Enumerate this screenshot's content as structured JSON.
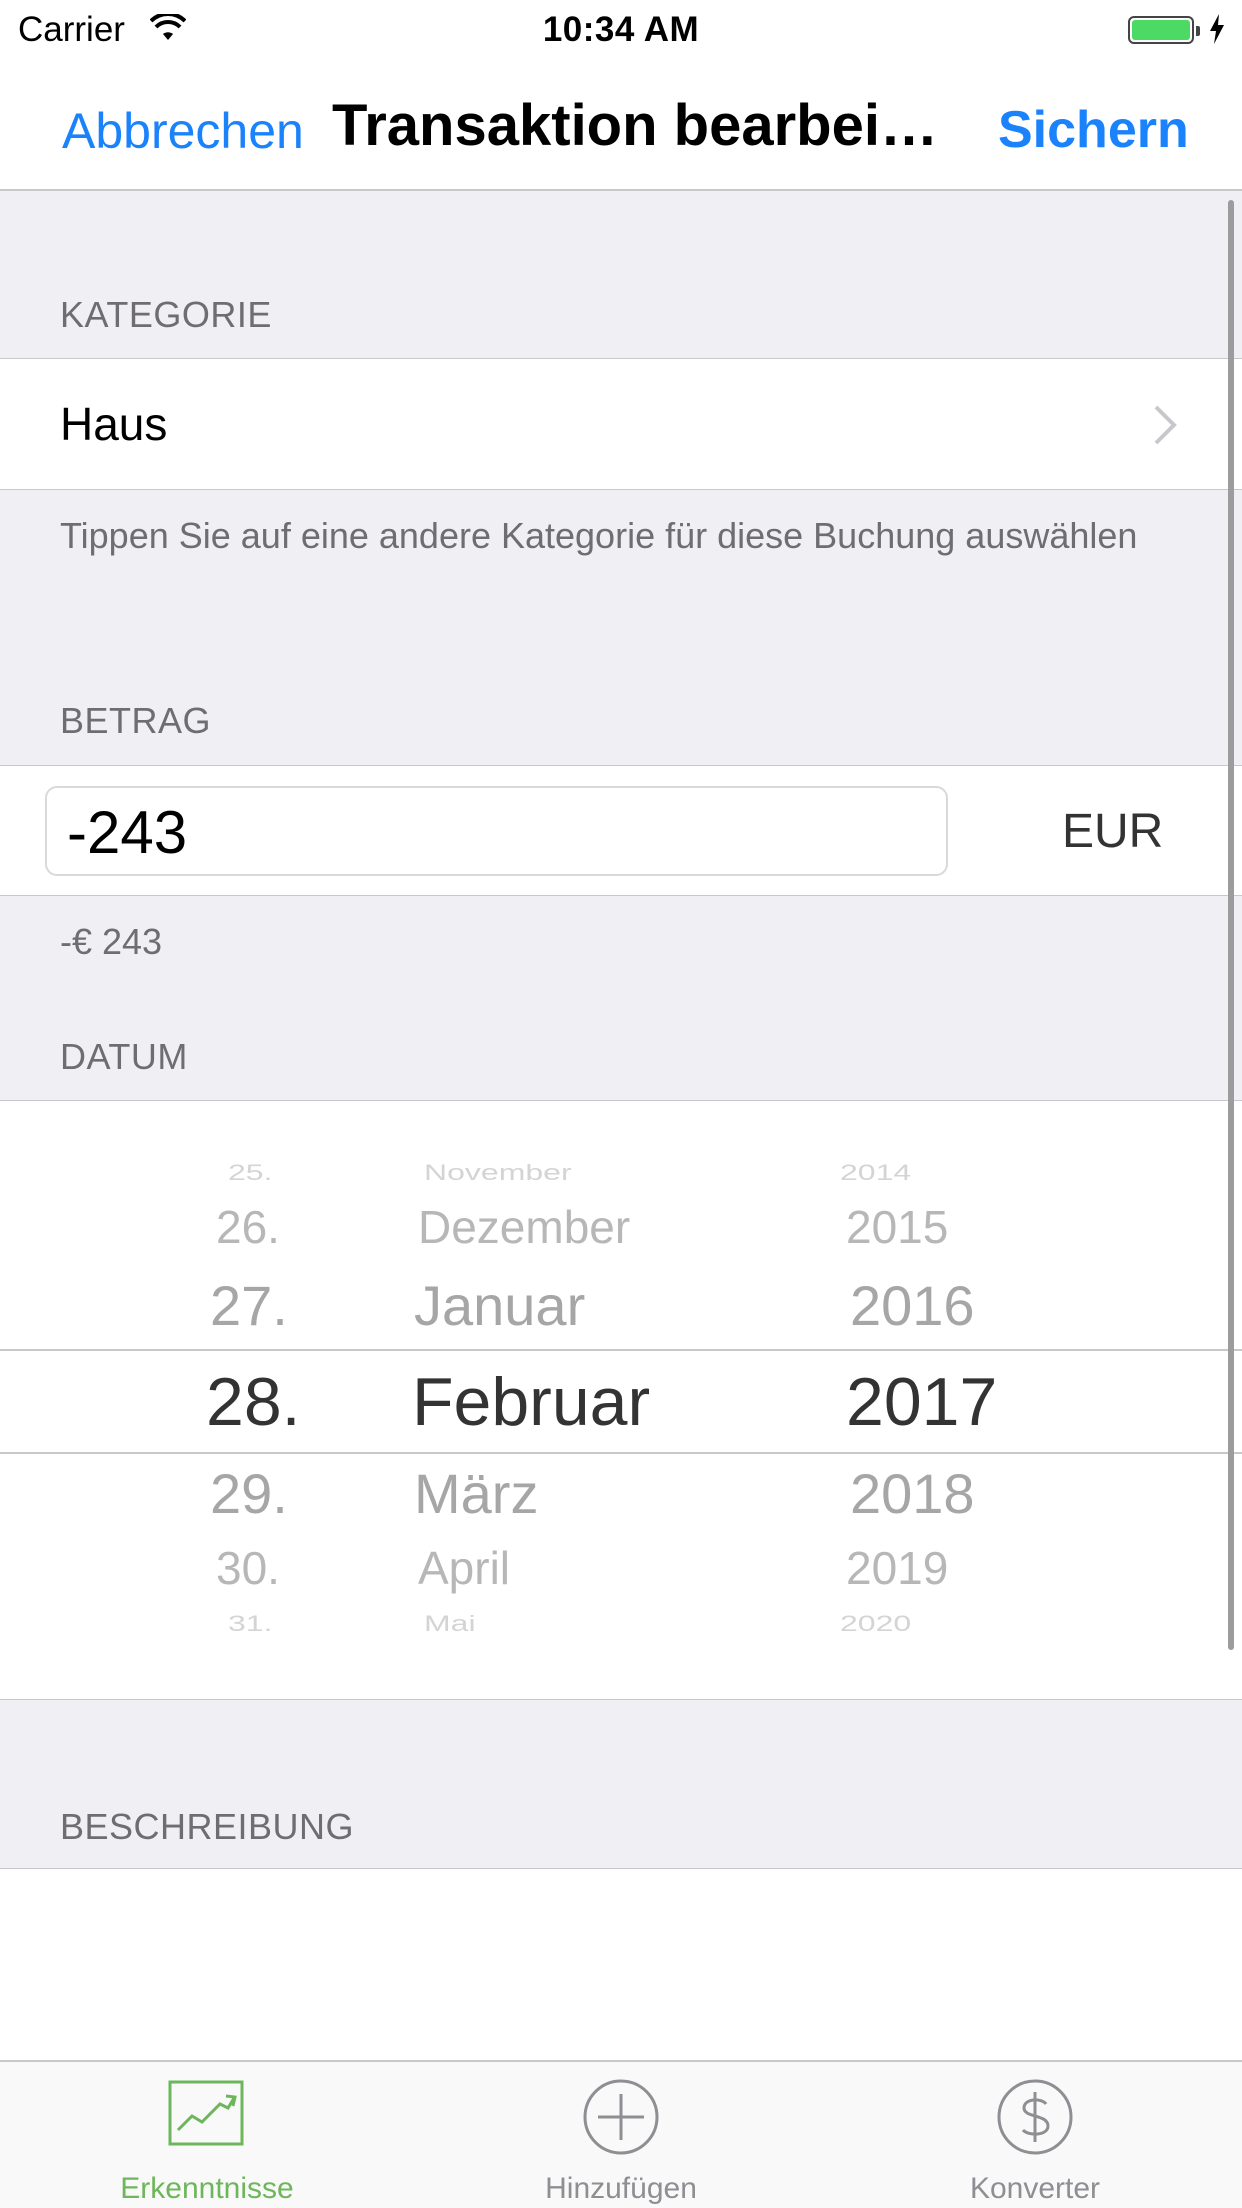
{
  "status_bar": {
    "carrier": "Carrier",
    "time": "10:34 AM"
  },
  "nav": {
    "cancel_label": "Abbrechen",
    "title": "Transaktion bearbei…",
    "save_label": "Sichern"
  },
  "category": {
    "header": "KATEGORIE",
    "value": "Haus",
    "footer": "Tippen Sie auf eine andere Kategorie für diese Buchung auswählen"
  },
  "amount": {
    "header": "BETRAG",
    "value": "-243",
    "currency": "EUR",
    "formatted": "-€ 243"
  },
  "date": {
    "header": "DATUM",
    "days": [
      "25.",
      "26.",
      "27.",
      "28.",
      "29.",
      "30.",
      "31."
    ],
    "months": [
      "November",
      "Dezember",
      "Januar",
      "Februar",
      "März",
      "April",
      "Mai"
    ],
    "years": [
      "2014",
      "2015",
      "2016",
      "2017",
      "2018",
      "2019",
      "2020"
    ],
    "selected": {
      "day": "28.",
      "month": "Februar",
      "year": "2017"
    }
  },
  "description": {
    "header": "BESCHREIBUNG"
  },
  "tabs": [
    {
      "label": "Erkenntnisse",
      "icon": "chart-trend-icon",
      "active": true
    },
    {
      "label": "Hinzufügen",
      "icon": "plus-circle-icon",
      "active": false
    },
    {
      "label": "Konverter",
      "icon": "dollar-circle-icon",
      "active": false
    }
  ],
  "colors": {
    "accent": "#1a82fb",
    "active_tab": "#6db65b",
    "inactive_tab": "#8e8e93",
    "battery": "#4cd964"
  }
}
